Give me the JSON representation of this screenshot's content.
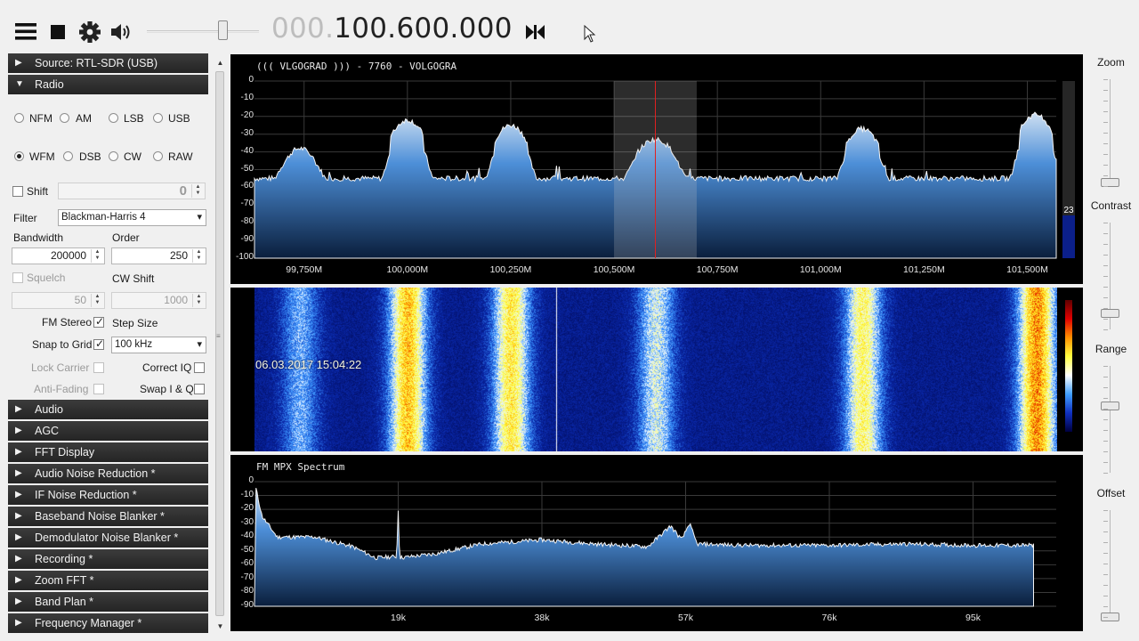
{
  "toolbar": {
    "frequency_prefix": "000.",
    "frequency_main": "100.600.000",
    "volume_level": 0.71
  },
  "left_panel": {
    "sections_top": [
      "Source: RTL-SDR (USB)",
      "Radio"
    ],
    "radio": {
      "modes_row1": [
        "NFM",
        "AM",
        "LSB",
        "USB"
      ],
      "modes_row2": [
        "WFM",
        "DSB",
        "CW",
        "RAW"
      ],
      "selected_mode": "WFM",
      "shift_label": "Shift",
      "shift_value": "0",
      "filter_label": "Filter",
      "filter_value": "Blackman-Harris 4",
      "bandwidth_label": "Bandwidth",
      "bandwidth_value": "200000",
      "order_label": "Order",
      "order_value": "250",
      "squelch_label": "Squelch",
      "squelch_value": "50",
      "cw_shift_label": "CW Shift",
      "cw_shift_value": "1000",
      "fm_stereo_label": "FM Stereo",
      "step_size_label": "Step Size",
      "snap_label": "Snap to Grid",
      "step_size_value": "100 kHz",
      "lock_carrier_label": "Lock Carrier",
      "correct_iq_label": "Correct IQ",
      "anti_fading_label": "Anti-Fading",
      "swap_iq_label": "Swap I & Q"
    },
    "sections_bottom": [
      "Audio",
      "AGC",
      "FFT Display",
      "Audio Noise Reduction *",
      "IF Noise Reduction *",
      "Baseband Noise Blanker *",
      "Demodulator Noise Blanker *",
      "Recording *",
      "Zoom FFT *",
      "Band Plan *",
      "Frequency Manager *"
    ]
  },
  "spectrum": {
    "title": "((( VLGOGRAD ))) - 7760 - VOLGOGRA",
    "y_ticks": [
      "0",
      "-10",
      "-20",
      "-30",
      "-40",
      "-50",
      "-60",
      "-70",
      "-80",
      "-90",
      "-100"
    ],
    "x_ticks": [
      "99,750M",
      "100,000M",
      "100,250M",
      "100,500M",
      "100,750M",
      "101,000M",
      "101,250M",
      "101,500M"
    ],
    "level_value": "23",
    "accent_color": "#3f86d8",
    "cursor_color": "#e02020"
  },
  "waterfall": {
    "timestamp": "06.03.2017 15:04:22"
  },
  "mpx": {
    "title": "FM MPX Spectrum",
    "y_ticks": [
      "0",
      "-10",
      "-20",
      "-30",
      "-40",
      "-50",
      "-60",
      "-70",
      "-80",
      "-90"
    ],
    "x_ticks": [
      "19k",
      "38k",
      "57k",
      "76k",
      "95k"
    ]
  },
  "right_panel": {
    "labels": [
      "Zoom",
      "Contrast",
      "Range",
      "Offset"
    ]
  },
  "chart_data": [
    {
      "type": "area",
      "title": "((( VLGOGRAD ))) - 7760 - VOLGOGRA",
      "xlabel": "",
      "ylabel": "",
      "ylim": [
        -100,
        0
      ],
      "xlim_mhz": [
        99.63,
        101.57
      ],
      "x_ticks": [
        "99,750M",
        "100,000M",
        "100,250M",
        "100,500M",
        "100,750M",
        "101,000M",
        "101,250M",
        "101,500M"
      ],
      "noise_floor_db": -55,
      "peaks": [
        {
          "x": 99.74,
          "y": -38
        },
        {
          "x": 100.0,
          "y": -22
        },
        {
          "x": 100.25,
          "y": -25
        },
        {
          "x": 100.6,
          "y": -33
        },
        {
          "x": 101.1,
          "y": -27
        },
        {
          "x": 101.52,
          "y": -19
        }
      ],
      "filter_band_mhz": [
        100.5,
        100.7
      ],
      "tuned_mhz": 100.6
    },
    {
      "type": "area",
      "title": "FM MPX Spectrum",
      "xlabel": "",
      "ylabel": "",
      "ylim": [
        -90,
        0
      ],
      "xlim_khz": [
        0,
        106
      ],
      "x_ticks": [
        "19k",
        "38k",
        "57k",
        "76k",
        "95k"
      ],
      "points": [
        {
          "x": 0.2,
          "y": -5
        },
        {
          "x": 1,
          "y": -25
        },
        {
          "x": 3,
          "y": -40
        },
        {
          "x": 8,
          "y": -40
        },
        {
          "x": 13,
          "y": -47
        },
        {
          "x": 16,
          "y": -55
        },
        {
          "x": 18.8,
          "y": -54
        },
        {
          "x": 19,
          "y": -20
        },
        {
          "x": 19.2,
          "y": -55
        },
        {
          "x": 24,
          "y": -52
        },
        {
          "x": 30,
          "y": -45
        },
        {
          "x": 38,
          "y": -42
        },
        {
          "x": 45,
          "y": -45
        },
        {
          "x": 52,
          "y": -47
        },
        {
          "x": 55,
          "y": -32
        },
        {
          "x": 56.5,
          "y": -42
        },
        {
          "x": 57.5,
          "y": -30
        },
        {
          "x": 58.5,
          "y": -45
        },
        {
          "x": 65,
          "y": -46
        },
        {
          "x": 76,
          "y": -46
        },
        {
          "x": 86,
          "y": -45
        },
        {
          "x": 95,
          "y": -46
        },
        {
          "x": 103,
          "y": -46
        }
      ]
    }
  ]
}
